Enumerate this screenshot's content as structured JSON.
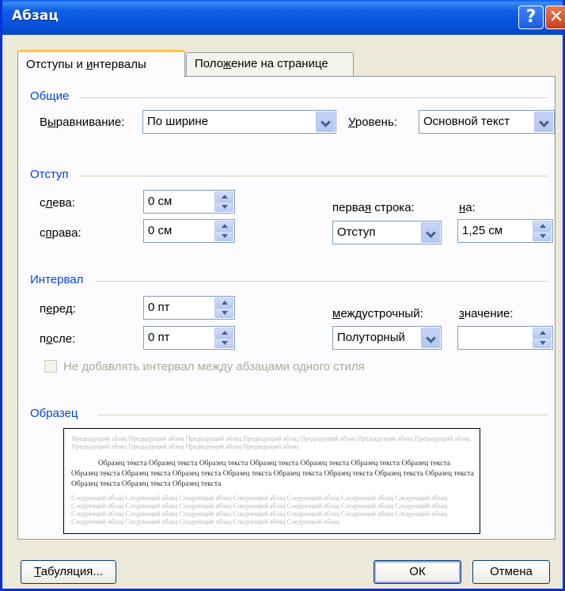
{
  "window": {
    "title": "Абзац",
    "help_glyph": "?",
    "close_glyph": "✕"
  },
  "tabs": [
    {
      "label_pre": "Отступы и ",
      "label_u": "и",
      "label_post": "нтервалы",
      "active": true
    },
    {
      "label_pre": "Поло",
      "label_u": "ж",
      "label_post": "ение на странице",
      "active": false
    }
  ],
  "general": {
    "section_title": "Общие",
    "alignment": {
      "label_pre": "В",
      "label_u": "ы",
      "label_post": "равнивание:",
      "value": "По ширине"
    },
    "level": {
      "label_pre": "",
      "label_u": "У",
      "label_post": "ровень:",
      "value": "Основной текст"
    }
  },
  "indent": {
    "section_title": "Отступ",
    "left": {
      "label_pre": "с",
      "label_u": "л",
      "label_post": "ева:",
      "value": "0 см"
    },
    "right": {
      "label_pre": "с",
      "label_u": "п",
      "label_post": "рава:",
      "value": "0 см"
    },
    "first_line": {
      "label_pre": "перва",
      "label_u": "я",
      "label_post": " строка:",
      "value": "Отступ"
    },
    "by": {
      "label_pre": "",
      "label_u": "н",
      "label_post": "а:",
      "value": "1,25 см"
    }
  },
  "spacing": {
    "section_title": "Интервал",
    "before": {
      "label_pre": "п",
      "label_u": "е",
      "label_post": "ред:",
      "value": "0 пт"
    },
    "after": {
      "label_pre": "п",
      "label_u": "о",
      "label_post": "сле:",
      "value": "0 пт"
    },
    "line_spacing": {
      "label_pre": "",
      "label_u": "м",
      "label_post": "еждустрочный:",
      "value": "Полуторный"
    },
    "at": {
      "label_pre": "",
      "label_u": "з",
      "label_post": "начение:",
      "value": ""
    },
    "dont_add_space": {
      "label": "Не добавлять интервал между абзацами одного стиля",
      "checked": false,
      "disabled": true
    }
  },
  "preview": {
    "section_title": "Образец",
    "previous_paragraph": "Предыдущий абзац Предыдущий абзац Предыдущий абзац Предыдущий абзац Предыдущий абзац Предыдущий абзац Предыдущий абзац Предыдущий абзац Предыдущий абзац Предыдущий абзац Предыдущий абзац",
    "sample_text": "Образец текста Образец текста Образец текста Образец текста Образец текста Образец текста Образец текста Образец текста Образец текста Образец текста Образец текста Образец текста Образец текста Образец текста Образец текста Образец текста Образец текста Образец текста",
    "next_paragraph": "Следующий абзац Следующий абзац Следующий абзац Следующий абзац Следующий абзац Следующий абзац Следующий абзац Следующий абзац Следующий абзац Следующий абзац Следующий абзац Следующий абзац Следующий абзац Следующий абзац Следующий абзац Следующий абзац Следующий абзац Следующий абзац Следующий абзац Следующий абзац Следующий абзац Следующий абзац Следующий абзац Следующий абзац Следующий абзац Следующий абзац"
  },
  "buttons": {
    "tabs": {
      "label_pre": "",
      "label_u": "Т",
      "label_post": "абуляция..."
    },
    "ok": "ОК",
    "cancel": "Отмена"
  },
  "colors": {
    "titlebar": "#0653dc",
    "section_title": "#0046d5",
    "dialog_bg": "#ece9d8",
    "tab_highlight": "#ffc83c"
  }
}
